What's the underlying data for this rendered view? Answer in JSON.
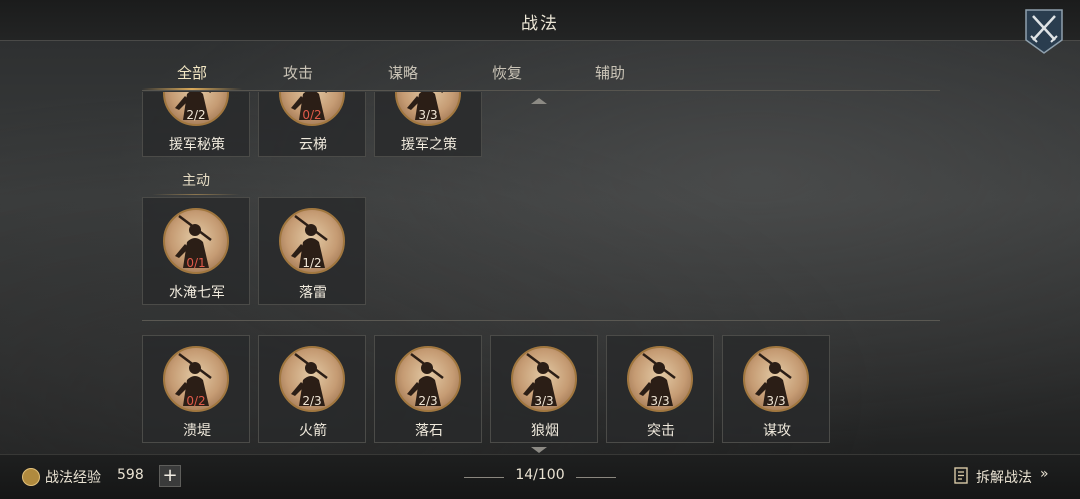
{
  "header": {
    "title": "战法"
  },
  "tabs": [
    {
      "label": "全部",
      "active": true
    },
    {
      "label": "攻击",
      "active": false
    },
    {
      "label": "谋略",
      "active": false
    },
    {
      "label": "恢复",
      "active": false
    },
    {
      "label": "辅助",
      "active": false
    }
  ],
  "top_row": [
    {
      "name": "援军秘策",
      "level": "2/2"
    },
    {
      "name": "云梯",
      "level": "0/2"
    },
    {
      "name": "援军之策",
      "level": "3/3"
    }
  ],
  "section_active": {
    "label": "主动"
  },
  "active_row": [
    {
      "name": "水淹七军",
      "level": "0/1"
    },
    {
      "name": "落雷",
      "level": "1/2"
    }
  ],
  "bottom_row": [
    {
      "name": "溃堤",
      "level": "0/2"
    },
    {
      "name": "火箭",
      "level": "2/3"
    },
    {
      "name": "落石",
      "level": "2/3"
    },
    {
      "name": "狼烟",
      "level": "3/3"
    },
    {
      "name": "突击",
      "level": "3/3"
    },
    {
      "name": "谋攻",
      "level": "3/3"
    }
  ],
  "footer": {
    "exp_label": "战法经验",
    "exp_value": "598",
    "plus_label": "+",
    "page_count": "14/100",
    "decompose_label": "拆解战法",
    "decompose_arrow": "»"
  },
  "colors": {
    "accent": "#d9a95a",
    "level_low": "#e05a4a"
  },
  "icons": [
    "crossed-swords-icon",
    "soldier-portrait-icon",
    "exp-coin-icon",
    "decompose-list-icon"
  ]
}
